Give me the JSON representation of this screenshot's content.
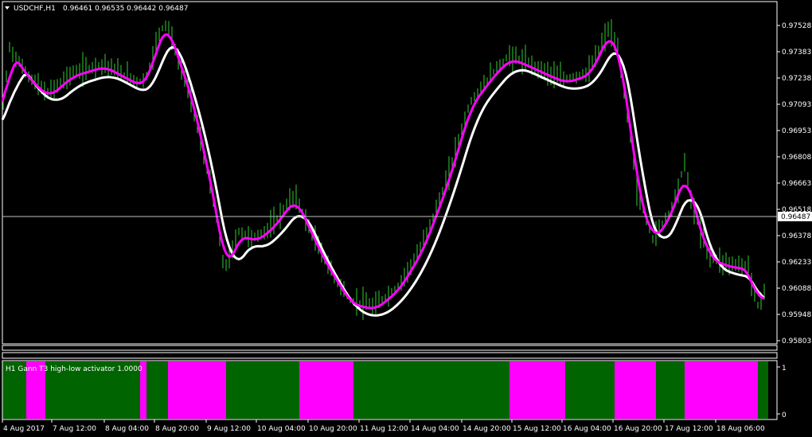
{
  "header": {
    "symbol_label": "USDCHF,H1",
    "ohlc_label": "0.96461 0.96535 0.96442 0.96487",
    "menu_icon": "triangle-down-icon"
  },
  "price_axis": {
    "ticks": [
      "0.97528",
      "0.97383",
      "0.97238",
      "0.97093",
      "0.96953",
      "0.96808",
      "0.96663",
      "0.96518",
      "0.96378",
      "0.96233",
      "0.96088",
      "0.95948",
      "0.95803"
    ],
    "current_price": "0.96487"
  },
  "indicator": {
    "title": "H1 Gann T3 high-low activator 1.0000",
    "scale_top": "1",
    "scale_bottom": "0",
    "bull_color": "#006400",
    "bear_color": "#ff00ff",
    "segments": [
      {
        "state": "bull",
        "from": 0,
        "to": 30
      },
      {
        "state": "bear",
        "from": 30,
        "to": 54
      },
      {
        "state": "bull",
        "from": 54,
        "to": 173
      },
      {
        "state": "bear",
        "from": 173,
        "to": 181
      },
      {
        "state": "bull",
        "from": 181,
        "to": 208
      },
      {
        "state": "bear",
        "from": 208,
        "to": 281
      },
      {
        "state": "bull",
        "from": 281,
        "to": 373
      },
      {
        "state": "bear",
        "from": 373,
        "to": 441
      },
      {
        "state": "bull",
        "from": 441,
        "to": 637
      },
      {
        "state": "bear",
        "from": 637,
        "to": 707
      },
      {
        "state": "bull",
        "from": 707,
        "to": 769
      },
      {
        "state": "bear",
        "from": 769,
        "to": 821
      },
      {
        "state": "bull",
        "from": 821,
        "to": 857
      },
      {
        "state": "bear",
        "from": 857,
        "to": 949
      },
      {
        "state": "bull",
        "from": 949,
        "to": 962
      }
    ]
  },
  "time_axis": {
    "labels": [
      "4 Aug 2017",
      "7 Aug 12:00",
      "8 Aug 04:00",
      "8 Aug 20:00",
      "9 Aug 12:00",
      "10 Aug 04:00",
      "10 Aug 20:00",
      "11 Aug 12:00",
      "14 Aug 04:00",
      "14 Aug 20:00",
      "15 Aug 12:00",
      "16 Aug 04:00",
      "16 Aug 20:00",
      "17 Aug 12:00",
      "18 Aug 06:00"
    ]
  },
  "colors": {
    "background": "#000000",
    "candles": "#32cd32",
    "fast_line": "#ff00ff",
    "slow_line": "#ffffff",
    "grid": "#ffffff"
  }
}
